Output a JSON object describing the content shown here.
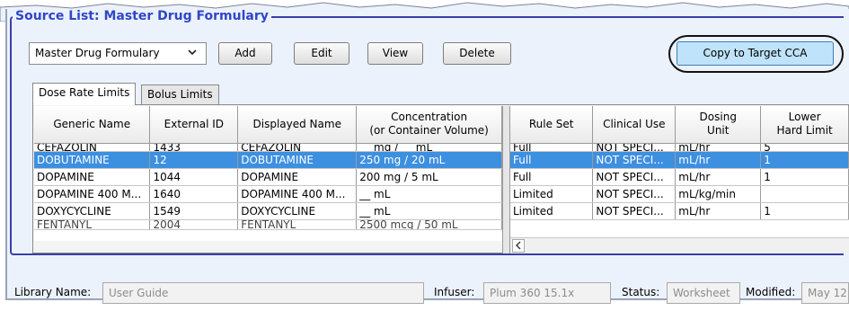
{
  "source_list": {
    "title": "Source List: Master Drug Formulary",
    "selector": {
      "value": "Master Drug Formulary"
    },
    "buttons": {
      "add": "Add",
      "edit": "Edit",
      "view": "View",
      "delete": "Delete",
      "copy": "Copy to Target CCA"
    }
  },
  "tabs": [
    {
      "label": "Dose Rate Limits",
      "active": true
    },
    {
      "label": "Bolus Limits",
      "active": false
    }
  ],
  "left_table": {
    "headers": [
      "Generic Name",
      "External ID",
      "Displayed Name",
      "Concentration\n(or Container Volume)"
    ],
    "rows": [
      [
        "CEFAZOLIN",
        "1433",
        "CEFAZOLIN",
        "__ mg / __ mL"
      ],
      [
        "DOBUTAMINE",
        "12",
        "DOBUTAMINE",
        "250 mg / 20 mL"
      ],
      [
        "DOPAMINE",
        "1044",
        "DOPAMINE",
        "200 mg / 5 mL"
      ],
      [
        "DOPAMINE 400 M...",
        "1640",
        "DOPAMINE 400 M...",
        "__ mL"
      ],
      [
        "DOXYCYCLINE",
        "1549",
        "DOXYCYCLINE",
        "__ mL"
      ],
      [
        "FENTANYL",
        "2004",
        "FENTANYL",
        "2500 mcg / 50 mL"
      ]
    ],
    "selected_row": 1
  },
  "right_table": {
    "headers": [
      "Rule Set",
      "Clinical Use",
      "Dosing\nUnit",
      "Lower\nHard Limit"
    ],
    "rows": [
      [
        "Full",
        "NOT SPECI...",
        "mL/hr",
        "5"
      ],
      [
        "Full",
        "NOT SPECI...",
        "mL/hr",
        "1"
      ],
      [
        "Full",
        "NOT SPECI...",
        "mL/hr",
        "1"
      ],
      [
        "Limited",
        "NOT SPECI...",
        "mL/kg/min",
        ""
      ],
      [
        "Limited",
        "NOT SPECI...",
        "mL/hr",
        "1"
      ]
    ],
    "selected_row": 1
  },
  "status_bar": {
    "library_name_label": "Library Name:",
    "library_name_value": "User Guide",
    "infuser_label": "Infuser:",
    "infuser_value": "Plum 360 15.1x",
    "status_label": "Status:",
    "status_value": "Worksheet",
    "modified_label": "Modified:",
    "modified_value": "May 12"
  },
  "colors": {
    "selection": "#3d8fe0",
    "legend_text": "#2f46c7",
    "copy_button": "#bfe3fa"
  },
  "icons": {
    "dropdown": "chevron-down-icon",
    "scroll_left": "arrow-left-icon"
  }
}
